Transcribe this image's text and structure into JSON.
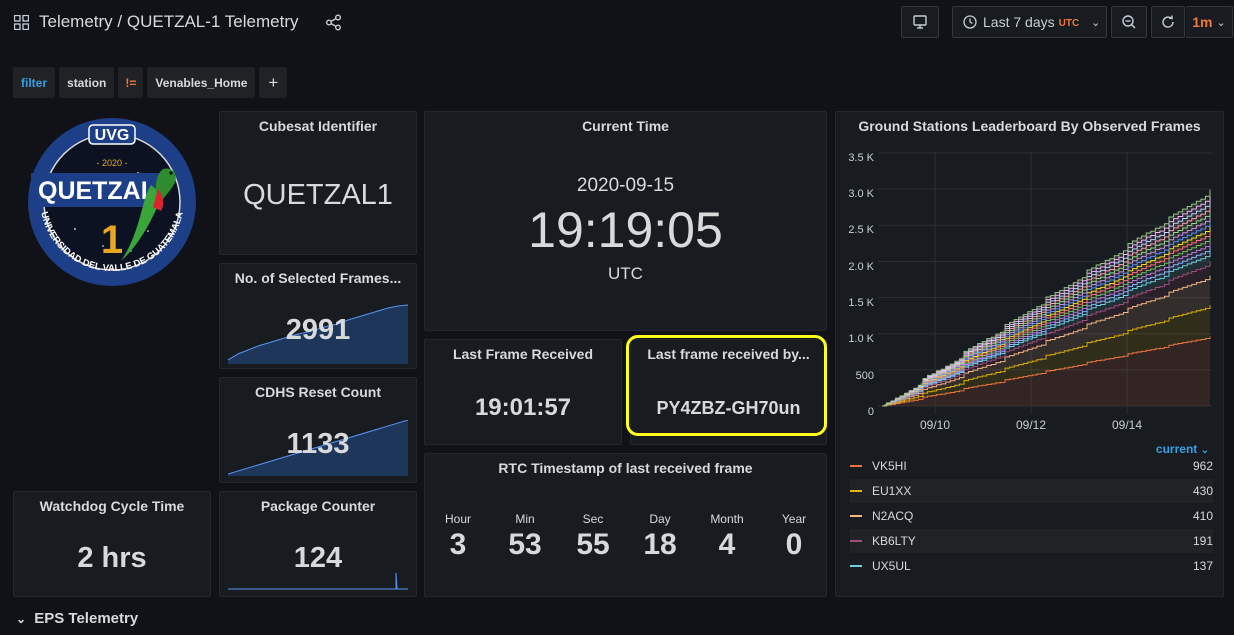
{
  "header": {
    "title": "Telemetry / QUETZAL-1 Telemetry",
    "time_range": "Last 7 days",
    "timezone": "UTC",
    "refresh": "1m"
  },
  "filters": {
    "key": "filter",
    "field": "station",
    "operator": "!=",
    "value": "Venables_Home",
    "add": "+"
  },
  "logo": {
    "top": "UVG",
    "year": "- 2020 -",
    "name": "QUETZAL",
    "number": "1",
    "ring": "UNIVERSIDAD DEL VALLE DE GUATEMALA"
  },
  "panels": {
    "cubesat": {
      "title": "Cubesat Identifier",
      "value": "QUETZAL1"
    },
    "current_time": {
      "title": "Current Time",
      "date": "2020-09-15",
      "time": "19:19:05",
      "tz": "UTC"
    },
    "frames": {
      "title": "No. of Selected Frames...",
      "value": "2991"
    },
    "cdhs": {
      "title": "CDHS Reset Count",
      "value": "1133"
    },
    "last_frame": {
      "title": "Last Frame Received",
      "value": "19:01:57"
    },
    "last_by": {
      "title": "Last frame received by...",
      "value": "PY4ZBZ-GH70un"
    },
    "watchdog": {
      "title": "Watchdog Cycle Time",
      "value": "2 hrs"
    },
    "package": {
      "title": "Package Counter",
      "value": "124"
    },
    "rtc": {
      "title": "RTC Timestamp of last received frame",
      "fields": [
        {
          "label": "Hour",
          "value": "3"
        },
        {
          "label": "Min",
          "value": "53"
        },
        {
          "label": "Sec",
          "value": "55"
        },
        {
          "label": "Day",
          "value": "18"
        },
        {
          "label": "Month",
          "value": "4"
        },
        {
          "label": "Year",
          "value": "0"
        }
      ]
    },
    "leaderboard": {
      "title": "Ground Stations Leaderboard By Observed Frames",
      "legend_header": "current"
    }
  },
  "row": {
    "label": "EPS Telemetry"
  },
  "chart_data": {
    "type": "area",
    "title": "Ground Stations Leaderboard By Observed Frames",
    "y_ticks": [
      "3.5 K",
      "3.0 K",
      "2.5 K",
      "2.0 K",
      "1.5 K",
      "1.0 K",
      "500",
      "0"
    ],
    "x_ticks": [
      "09/10",
      "09/12",
      "09/14"
    ],
    "ylim": [
      0,
      3500
    ],
    "stacked": true,
    "total_current": 2991,
    "legend_placement": "bottom",
    "series": [
      {
        "name": "VK5HI",
        "current": 962,
        "color": "#f2773e"
      },
      {
        "name": "EU1XX",
        "current": 430,
        "color": "#e0b400"
      },
      {
        "name": "N2ACQ",
        "current": 410,
        "color": "#f9b882"
      },
      {
        "name": "KB6LTY",
        "current": 191,
        "color": "#a34d7e"
      },
      {
        "name": "UX5UL",
        "current": 137,
        "color": "#6ed0e0"
      }
    ]
  }
}
